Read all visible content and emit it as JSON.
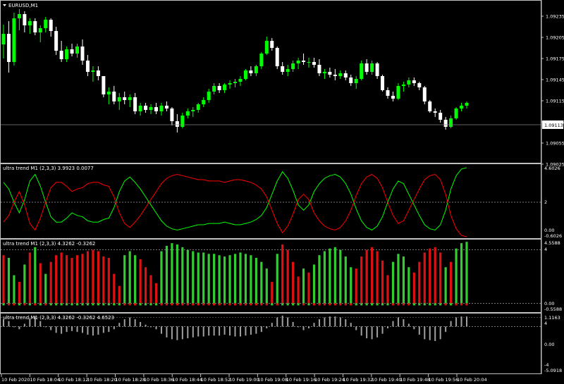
{
  "main": {
    "symbol_label": "EURUSD,M1",
    "price_labels": [
      "1.09235",
      "1.09205",
      "1.09175",
      "1.09145",
      "1.09115",
      "1.09085",
      "1.09055",
      "1.09025"
    ],
    "current_price": "1.09113",
    "y_range": [
      1.0903,
      1.0925
    ],
    "bull_color": "#00ff00",
    "bear_color": "#ffffff",
    "candles": [
      [
        1.09195,
        1.09223,
        1.09175,
        1.0921
      ],
      [
        1.0921,
        1.09228,
        1.09155,
        1.0917
      ],
      [
        1.0917,
        1.0924,
        1.09165,
        1.09232
      ],
      [
        1.09232,
        1.09245,
        1.09215,
        1.09238
      ],
      [
        1.09238,
        1.09242,
        1.09212,
        1.09222
      ],
      [
        1.09222,
        1.09232,
        1.0921,
        1.09228
      ],
      [
        1.09228,
        1.09232,
        1.09208,
        1.09212
      ],
      [
        1.09212,
        1.09222,
        1.09198,
        1.09218
      ],
      [
        1.09218,
        1.09234,
        1.09212,
        1.0923
      ],
      [
        1.0923,
        1.09232,
        1.09206,
        1.09214
      ],
      [
        1.09214,
        1.0922,
        1.0918,
        1.09186
      ],
      [
        1.09186,
        1.092,
        1.0917,
        1.09174
      ],
      [
        1.09174,
        1.09192,
        1.0917,
        1.09188
      ],
      [
        1.09188,
        1.09196,
        1.09178,
        1.09182
      ],
      [
        1.09182,
        1.09196,
        1.09176,
        1.09192
      ],
      [
        1.09192,
        1.09202,
        1.09166,
        1.09172
      ],
      [
        1.09172,
        1.0918,
        1.0915,
        1.09156
      ],
      [
        1.09156,
        1.09164,
        1.09142,
        1.09158
      ],
      [
        1.09158,
        1.09164,
        1.09144,
        1.0915
      ],
      [
        1.0915,
        1.0915,
        1.0912,
        1.09124
      ],
      [
        1.09124,
        1.09134,
        1.0911,
        1.09128
      ],
      [
        1.09128,
        1.09136,
        1.0911,
        1.09114
      ],
      [
        1.09114,
        1.09126,
        1.09102,
        1.0912
      ],
      [
        1.0912,
        1.09128,
        1.0911,
        1.09116
      ],
      [
        1.09116,
        1.09124,
        1.09106,
        1.0912
      ],
      [
        1.0912,
        1.09126,
        1.09096,
        1.091
      ],
      [
        1.091,
        1.09112,
        1.09094,
        1.09108
      ],
      [
        1.09108,
        1.09112,
        1.09098,
        1.09102
      ],
      [
        1.09102,
        1.0911,
        1.09096,
        1.09106
      ],
      [
        1.09106,
        1.09112,
        1.09096,
        1.091
      ],
      [
        1.091,
        1.09112,
        1.09094,
        1.09108
      ],
      [
        1.09108,
        1.09114,
        1.091,
        1.09104
      ],
      [
        1.09104,
        1.09106,
        1.0908,
        1.09086
      ],
      [
        1.09086,
        1.09096,
        1.0907,
        1.09078
      ],
      [
        1.09078,
        1.09098,
        1.09076,
        1.09094
      ],
      [
        1.09094,
        1.09104,
        1.0909,
        1.091
      ],
      [
        1.091,
        1.09106,
        1.09092,
        1.09102
      ],
      [
        1.09102,
        1.09112,
        1.09098,
        1.0911
      ],
      [
        1.0911,
        1.0912,
        1.09106,
        1.09116
      ],
      [
        1.09116,
        1.09132,
        1.09112,
        1.09128
      ],
      [
        1.09128,
        1.0914,
        1.09124,
        1.09136
      ],
      [
        1.09136,
        1.0914,
        1.09126,
        1.0913
      ],
      [
        1.0913,
        1.0914,
        1.09126,
        1.09138
      ],
      [
        1.09138,
        1.09144,
        1.09132,
        1.0914
      ],
      [
        1.0914,
        1.09146,
        1.09134,
        1.09142
      ],
      [
        1.09142,
        1.0915,
        1.09136,
        1.09146
      ],
      [
        1.09146,
        1.0916,
        1.09144,
        1.09158
      ],
      [
        1.09158,
        1.09164,
        1.0915,
        1.09154
      ],
      [
        1.09154,
        1.09166,
        1.0915,
        1.09164
      ],
      [
        1.09164,
        1.09184,
        1.0916,
        1.09182
      ],
      [
        1.09182,
        1.09206,
        1.0918,
        1.092
      ],
      [
        1.092,
        1.09204,
        1.09186,
        1.0919
      ],
      [
        1.0919,
        1.09192,
        1.0916,
        1.09164
      ],
      [
        1.09164,
        1.0917,
        1.09152,
        1.09156
      ],
      [
        1.09156,
        1.09166,
        1.0915,
        1.0916
      ],
      [
        1.0916,
        1.09172,
        1.09156,
        1.09168
      ],
      [
        1.09168,
        1.09176,
        1.0916,
        1.09172
      ],
      [
        1.09172,
        1.09182,
        1.09166,
        1.0917
      ],
      [
        1.0917,
        1.09176,
        1.09162,
        1.0917
      ],
      [
        1.0917,
        1.09176,
        1.09162,
        1.09166
      ],
      [
        1.09166,
        1.09174,
        1.0915,
        1.09154
      ],
      [
        1.09154,
        1.0916,
        1.09146,
        1.09156
      ],
      [
        1.09156,
        1.09162,
        1.09148,
        1.09152
      ],
      [
        1.09152,
        1.0916,
        1.09144,
        1.0915
      ],
      [
        1.0915,
        1.09158,
        1.09146,
        1.09154
      ],
      [
        1.09154,
        1.09158,
        1.09144,
        1.09148
      ],
      [
        1.09148,
        1.09152,
        1.09136,
        1.0914
      ],
      [
        1.0914,
        1.0915,
        1.09132,
        1.09146
      ],
      [
        1.09146,
        1.09172,
        1.09144,
        1.09168
      ],
      [
        1.09168,
        1.09174,
        1.09152,
        1.09156
      ],
      [
        1.09156,
        1.09172,
        1.09152,
        1.09168
      ],
      [
        1.09168,
        1.0917,
        1.09146,
        1.0915
      ],
      [
        1.0915,
        1.09152,
        1.09128,
        1.0913
      ],
      [
        1.0913,
        1.09134,
        1.09118,
        1.09122
      ],
      [
        1.09122,
        1.09128,
        1.09114,
        1.09118
      ],
      [
        1.09118,
        1.0914,
        1.09116,
        1.09136
      ],
      [
        1.09136,
        1.09142,
        1.09128,
        1.09138
      ],
      [
        1.09138,
        1.09148,
        1.09134,
        1.09144
      ],
      [
        1.09144,
        1.09148,
        1.09136,
        1.0914
      ],
      [
        1.0914,
        1.09142,
        1.0913,
        1.09134
      ],
      [
        1.09134,
        1.09136,
        1.0911,
        1.09114
      ],
      [
        1.09114,
        1.09116,
        1.09098,
        1.091
      ],
      [
        1.091,
        1.09104,
        1.09092,
        1.09098
      ],
      [
        1.09098,
        1.09102,
        1.09084,
        1.09088
      ],
      [
        1.09088,
        1.09092,
        1.09074,
        1.09078
      ],
      [
        1.09078,
        1.09094,
        1.09076,
        1.0909
      ],
      [
        1.0909,
        1.09106,
        1.09088,
        1.09104
      ],
      [
        1.09104,
        1.09112,
        1.091,
        1.09108
      ],
      [
        1.09108,
        1.09114,
        1.09104,
        1.09112
      ]
    ]
  },
  "panel1": {
    "label": "ultra trend M1 (2,3,3) 3.9923 0.0077",
    "scale": [
      "4.6026",
      "2",
      "0.00",
      "-0.6026"
    ],
    "range": [
      -0.6026,
      4.6026
    ],
    "level": 2,
    "green_color": "#00ff00",
    "red_color": "#ff0000",
    "green": [
      3.5,
      3.0,
      2.0,
      1.2,
      2.2,
      3.6,
      4.1,
      3.2,
      2.0,
      0.9,
      0.5,
      0.5,
      0.8,
      1.2,
      1.0,
      0.9,
      0.6,
      0.5,
      0.5,
      0.7,
      0.8,
      1.6,
      2.8,
      3.6,
      3.9,
      3.5,
      3.0,
      2.4,
      1.8,
      1.2,
      0.6,
      0.2,
      0.0,
      -0.1,
      0.0,
      0.1,
      0.2,
      0.3,
      0.3,
      0.4,
      0.4,
      0.4,
      0.5,
      0.4,
      0.3,
      0.3,
      0.4,
      0.5,
      0.7,
      1.0,
      1.6,
      2.6,
      3.6,
      4.3,
      3.8,
      2.9,
      1.8,
      1.4,
      1.8,
      2.8,
      3.4,
      3.8,
      4.0,
      4.1,
      3.9,
      3.4,
      2.6,
      1.5,
      0.6,
      0.1,
      -0.1,
      0.2,
      0.9,
      2.0,
      3.0,
      3.6,
      3.4,
      2.6,
      1.8,
      1.0,
      0.3,
      0.0,
      -0.1,
      0.3,
      1.4,
      3.0,
      4.0,
      4.5,
      4.6
    ],
    "red": [
      0.5,
      1.0,
      2.0,
      2.8,
      1.8,
      0.4,
      -0.1,
      0.8,
      2.0,
      3.1,
      3.5,
      3.5,
      3.2,
      2.8,
      3.0,
      3.1,
      3.4,
      3.5,
      3.5,
      3.3,
      3.2,
      2.4,
      1.2,
      0.4,
      0.1,
      0.5,
      1.0,
      1.6,
      2.2,
      2.8,
      3.4,
      3.8,
      4.0,
      4.1,
      4.0,
      3.9,
      3.8,
      3.7,
      3.7,
      3.6,
      3.6,
      3.6,
      3.5,
      3.6,
      3.7,
      3.7,
      3.6,
      3.5,
      3.3,
      3.0,
      2.4,
      1.4,
      0.4,
      -0.3,
      0.2,
      1.1,
      2.2,
      2.6,
      2.2,
      1.2,
      0.6,
      0.2,
      0.0,
      -0.1,
      0.1,
      0.6,
      1.4,
      2.5,
      3.4,
      3.9,
      4.1,
      3.8,
      3.1,
      2.0,
      1.0,
      0.4,
      0.6,
      1.4,
      2.2,
      3.0,
      3.7,
      4.0,
      4.1,
      3.7,
      2.6,
      1.0,
      0.0,
      -0.5,
      -0.6
    ]
  },
  "panel2": {
    "label": "ultra trend M1 (2,3,3) 4.3262 -0.3262",
    "scale": [
      "4.5588",
      "4",
      "0.00",
      "-0.5588"
    ],
    "range": [
      -0.5588,
      4.5588
    ],
    "green_color": "#33cc33",
    "red_color": "#dd1111",
    "values": [
      3.6,
      3.4,
      2.1,
      1.6,
      2.9,
      3.8,
      4.2,
      3.0,
      2.2,
      3.1,
      3.6,
      3.8,
      3.6,
      3.4,
      3.6,
      3.7,
      3.9,
      4.0,
      3.9,
      3.5,
      3.4,
      2.2,
      1.3,
      3.6,
      3.9,
      3.6,
      3.3,
      2.7,
      2.1,
      1.5,
      3.9,
      4.3,
      4.5,
      4.4,
      4.2,
      4.0,
      3.9,
      3.8,
      3.8,
      3.7,
      3.7,
      3.6,
      3.5,
      3.6,
      3.7,
      3.8,
      3.7,
      3.6,
      3.4,
      3.1,
      2.6,
      1.6,
      3.7,
      4.4,
      4.0,
      3.1,
      2.0,
      2.6,
      2.3,
      2.9,
      3.6,
      3.9,
      4.1,
      4.2,
      4.0,
      3.5,
      2.7,
      2.6,
      3.5,
      4.0,
      4.2,
      3.9,
      3.2,
      2.1,
      3.1,
      3.7,
      3.5,
      2.7,
      2.3,
      3.1,
      3.8,
      4.1,
      4.2,
      3.8,
      2.7,
      3.1,
      4.1,
      4.5,
      4.6
    ],
    "colors": [
      "r",
      "g",
      "g",
      "r",
      "g",
      "r",
      "g",
      "r",
      "g",
      "r",
      "r",
      "r",
      "r",
      "r",
      "r",
      "r",
      "r",
      "r",
      "r",
      "r",
      "r",
      "r",
      "r",
      "g",
      "g",
      "g",
      "r",
      "r",
      "r",
      "r",
      "g",
      "g",
      "g",
      "g",
      "g",
      "g",
      "g",
      "g",
      "g",
      "g",
      "g",
      "g",
      "g",
      "g",
      "g",
      "g",
      "g",
      "g",
      "g",
      "g",
      "g",
      "r",
      "g",
      "r",
      "r",
      "r",
      "r",
      "g",
      "r",
      "g",
      "g",
      "g",
      "g",
      "g",
      "g",
      "g",
      "g",
      "r",
      "r",
      "r",
      "r",
      "r",
      "r",
      "r",
      "g",
      "g",
      "g",
      "g",
      "r",
      "r",
      "r",
      "r",
      "r",
      "r",
      "g",
      "r",
      "g",
      "g",
      "g"
    ]
  },
  "panel3": {
    "label": "ultra trend M1 (2,3,3) 4.3262 -0.3262 4.6523",
    "scale": [
      "1.1163",
      "0.00",
      "-5.0918"
    ],
    "inner_ticks": [
      "4",
      "-4"
    ],
    "range": [
      -5.0918,
      1.1163
    ],
    "bar_color": "#a0a0a0",
    "values": [
      0.8,
      0.6,
      0.0,
      -0.3,
      0.3,
      0.9,
      1.1,
      0.6,
      0.0,
      -0.4,
      -0.7,
      -0.8,
      -0.6,
      -0.5,
      -0.6,
      -0.7,
      -0.9,
      -1.0,
      -0.9,
      -0.7,
      -0.6,
      -0.3,
      0.4,
      0.8,
      1.0,
      0.8,
      0.5,
      0.2,
      0.0,
      -0.3,
      -0.8,
      -1.2,
      -1.4,
      -1.5,
      -1.4,
      -1.3,
      -1.2,
      -1.1,
      -1.1,
      -1.0,
      -1.0,
      -1.0,
      -0.9,
      -1.0,
      -1.1,
      -1.1,
      -1.0,
      -0.9,
      -0.8,
      -0.6,
      -0.2,
      0.4,
      1.0,
      1.2,
      1.0,
      0.5,
      0.0,
      -0.4,
      -0.2,
      0.4,
      0.8,
      1.0,
      1.1,
      1.1,
      1.0,
      0.8,
      0.4,
      -0.4,
      -1.0,
      -1.3,
      -1.4,
      -1.2,
      -0.8,
      -0.2,
      0.6,
      1.0,
      0.8,
      0.3,
      -0.3,
      -0.9,
      -1.4,
      -1.5,
      -1.6,
      -1.4,
      -0.6,
      0.6,
      1.0,
      1.1,
      1.1
    ]
  },
  "time_labels": [
    "10 Feb 2020",
    "10 Feb 18:04",
    "10 Feb 18:12",
    "10 Feb 18:20",
    "10 Feb 18:28",
    "10 Feb 18:36",
    "10 Feb 18:44",
    "10 Feb 18:52",
    "10 Feb 19:00",
    "10 Feb 19:08",
    "10 Feb 19:16",
    "10 Feb 19:24",
    "10 Feb 19:32",
    "10 Feb 19:40",
    "10 Feb 19:48",
    "10 Feb 19:56",
    "10 Feb 20:04"
  ]
}
